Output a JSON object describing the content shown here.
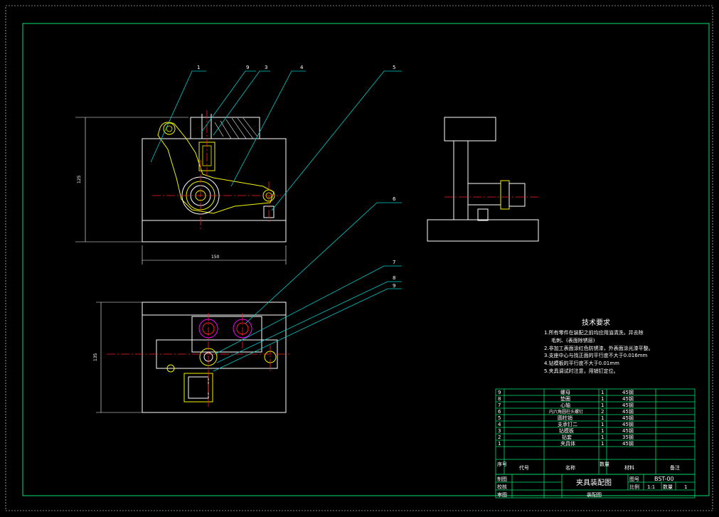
{
  "callouts": [
    "1",
    "9",
    "3",
    "4",
    "5",
    "6",
    "7",
    "8",
    "9"
  ],
  "dimensions": {
    "front_height": "125",
    "front_width": "150",
    "top_height": "135"
  },
  "tech_requirements": {
    "title": "技术要求",
    "items": [
      "1.所有零件在装配之前均应用油清洗，并去除",
      "毛刺、(表面除锈层)",
      "2.非加工表面涂红色防锈漆，外表面涂光漆平整。",
      "3.支座中心与找正面的平行度不大于0.016mm",
      "4.钻模板的平行度不大于0.01mm",
      "5.夹具调试时注意，用销钉定位。"
    ]
  },
  "bom": {
    "rows": [
      {
        "no": "9",
        "name": "螺母",
        "qty": "1",
        "material": "45钢",
        "note": ""
      },
      {
        "no": "8",
        "name": "垫圈",
        "qty": "1",
        "material": "45钢",
        "note": ""
      },
      {
        "no": "7",
        "name": "心轴",
        "qty": "1",
        "material": "45钢",
        "note": ""
      },
      {
        "no": "6",
        "name": "内六角圆柱头螺钉",
        "qty": "2",
        "material": "45钢",
        "note": ""
      },
      {
        "no": "5",
        "name": "圆柱销",
        "qty": "1",
        "material": "45钢",
        "note": ""
      },
      {
        "no": "4",
        "name": "支承钉二",
        "qty": "1",
        "material": "45钢",
        "note": ""
      },
      {
        "no": "3",
        "name": "钻模板",
        "qty": "1",
        "material": "45钢",
        "note": ""
      },
      {
        "no": "2",
        "name": "钻套",
        "qty": "1",
        "material": "35钢",
        "note": ""
      },
      {
        "no": "1",
        "name": "夹具体",
        "qty": "1",
        "material": "45钢",
        "note": ""
      }
    ],
    "header": {
      "no": "序号",
      "code": "代号",
      "name": "名称",
      "qty": "数量",
      "material": "材料",
      "note": "备注"
    }
  },
  "title_block": {
    "row_labels": [
      "制图",
      "校核",
      "审图"
    ],
    "drawing_name": "夹具装配图",
    "drawing_no_label": "图号",
    "drawing_no": "BST-00",
    "scale_label": "比例",
    "scale": "1:1",
    "qty_label": "数量",
    "qty": "1",
    "subtitle": "装配图"
  },
  "colors": {
    "background": "#000000",
    "frame": "#00e070",
    "outline": "#ffffff",
    "part": "#f2f200",
    "center": "#ff2020",
    "leader": "#00cccc",
    "accent": "#ff00ff"
  }
}
